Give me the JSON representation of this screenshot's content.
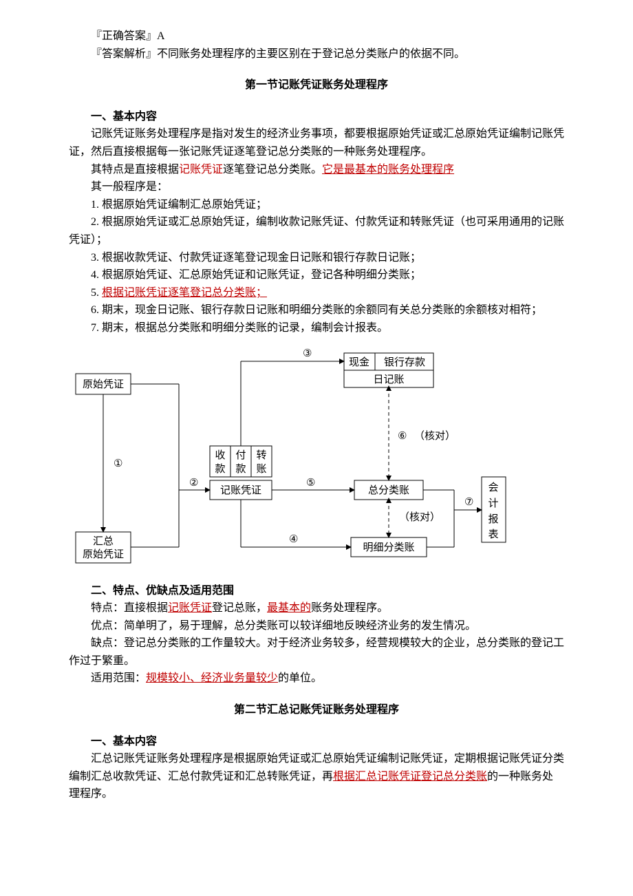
{
  "answer": {
    "correct_label": "『正确答案』A",
    "explain_prefix": "『答案解析』",
    "explain_text": "不同账务处理程序的主要区别在于登记总分类账户的依据不同。"
  },
  "section1": {
    "title": "第一节记账凭证账务处理程序",
    "h_basic": "一、基本内容",
    "p1": "记账凭证账务处理程序是指对发生的经济业务事项，都要根据原始凭证或汇总原始凭证编制记账凭证，然后直接根据每一张记账凭证逐笔登记总分类账的一种账务处理程序。",
    "p2_pre": "其特点是直接根据",
    "p2_red1": "记账凭证",
    "p2_mid": "逐笔登记总分类账。",
    "p2_red2": "它是最基本的账务处理程序",
    "p3": "其一般程序是：",
    "li1": "1. 根据原始凭证编制汇总原始凭证；",
    "li2": "2. 根据原始凭证或汇总原始凭证，编制收款记账凭证、付款凭证和转账凭证（也可采用通用的记账凭证）；",
    "li3": "3. 根据收款凭证、付款凭证逐笔登记现金日记账和银行存款日记账；",
    "li4": "4. 根据原始凭证、汇总原始凭证和记账凭证，登记各种明细分类账；",
    "li5_pre": "5. ",
    "li5_red": "根据记账凭证逐笔登记总分类账；",
    "li6": "6. 期末，现金日记账、银行存款日记账和明细分类账的余额同有关总分类账的余额核对相符；",
    "li7": "7. 期末，根据总分类账和明细分类账的记录，编制会计报表。",
    "h_feat": "二、特点、优缺点及适用范围",
    "feat_pre": "特点：直接根据",
    "feat_red1": "记账凭证",
    "feat_mid": "登记总账，",
    "feat_red2": "最基本的",
    "feat_end": "账务处理程序。",
    "adv": "优点：简单明了，易于理解，总分类账可以较详细地反映经济业务的发生情况。",
    "dis": "缺点：登记总分类账的工作量较大。对于经济业务较多，经营规模较大的企业，总分类账的登记工作过于繁重。",
    "scope_pre": "适用范围：",
    "scope_red": "规模较小、经济业务量较少",
    "scope_end": "的单位。"
  },
  "diagram": {
    "box_yuanshi": "原始凭证",
    "box_huizong1": "汇总",
    "box_huizong2": "原始凭证",
    "box_sk": "收",
    "box_fk": "付",
    "box_zz": "转",
    "box_sk2": "款",
    "box_fk2": "款",
    "box_zz2": "账",
    "box_jzpz": "记账凭证",
    "box_xj": "现金",
    "box_yh": "银行存款",
    "box_rjz": "日记账",
    "box_zfl": "总分类账",
    "box_mxfl": "明细分类账",
    "box_bb1": "会",
    "box_bb2": "计",
    "box_bb3": "报",
    "box_bb4": "表",
    "n1": "①",
    "n2": "②",
    "n3": "③",
    "n4": "④",
    "n5": "⑤",
    "n6": "⑥",
    "n7": "⑦",
    "hd1": "（核对）",
    "hd2": "（核对）"
  },
  "section2": {
    "title": "第二节汇总记账凭证账务处理程序",
    "h_basic": "一、基本内容",
    "p1_pre": "汇总记账凭证账务处理程序是根据原始凭证或汇总原始凭证编制记账凭证，定期根据记账凭证分类编制汇总收款凭证、汇总付款凭证和汇总转账凭证，再",
    "p1_red": "根据汇总记账凭证登记总分类账",
    "p1_end": "的一种账务处理程序。"
  }
}
